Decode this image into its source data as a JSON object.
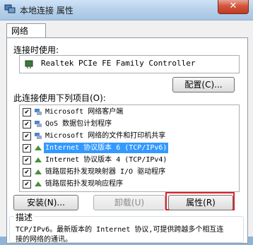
{
  "window": {
    "title": "本地连接 属性",
    "close_label": "✕"
  },
  "tabs": [
    {
      "label": "网络"
    }
  ],
  "connect_using": {
    "label": "连接时使用:",
    "adapter": "Realtek PCIe FE Family Controller",
    "configure_button": "配置(C)..."
  },
  "items_section": {
    "label": "此连接使用下列项目(O):",
    "items": [
      {
        "label": "Microsoft 网络客户端",
        "checked": true,
        "icon": "network-client-icon"
      },
      {
        "label": "QoS 数据包计划程序",
        "checked": true,
        "icon": "qos-icon"
      },
      {
        "label": "Microsoft 网络的文件和打印机共享",
        "checked": true,
        "icon": "file-share-icon"
      },
      {
        "label": "Internet 协议版本 6 (TCP/IPv6)",
        "checked": true,
        "icon": "protocol-icon",
        "selected": true
      },
      {
        "label": "Internet 协议版本 4 (TCP/IPv4)",
        "checked": true,
        "icon": "protocol-icon"
      },
      {
        "label": "链路层拓扑发现映射器 I/O 驱动程序",
        "checked": true,
        "icon": "protocol-icon"
      },
      {
        "label": "链路层拓扑发现响应程序",
        "checked": true,
        "icon": "protocol-icon"
      }
    ]
  },
  "buttons": {
    "install": "安装(N)...",
    "uninstall": "卸载(U)",
    "properties": "属性(R)"
  },
  "description": {
    "title": "描述",
    "text": "TCP/IPv6。最新版本的 Internet 协议,可提供跨越多个相互连接的网络的通讯。"
  },
  "colors": {
    "selection": "#3399ff",
    "highlight_border": "#e0202a"
  }
}
